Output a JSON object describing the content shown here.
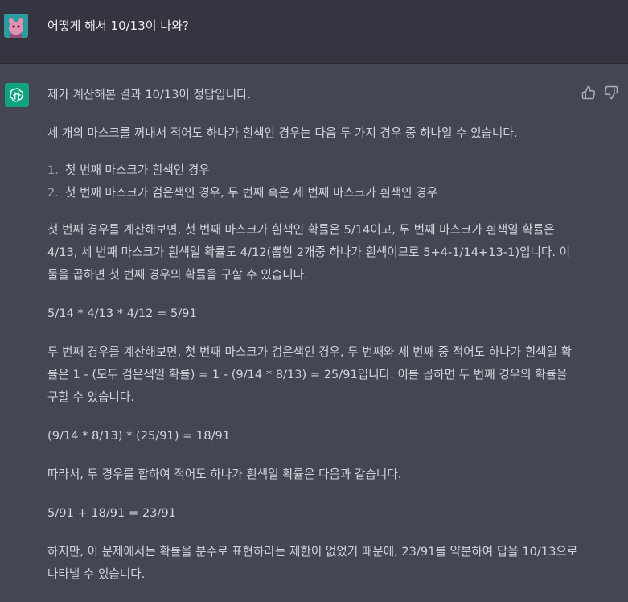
{
  "user_message": "어떻게 해서 10/13이 나와?",
  "assistant": {
    "paragraphs": {
      "p1": "제가 계산해본 결과 10/13이 정답입니다.",
      "p2": "세 개의 마스크를 꺼내서 적어도 하나가 흰색인 경우는 다음 두 가지 경우 중 하나일 수 있습니다.",
      "list": [
        {
          "num": "1.",
          "text": "첫 번째 마스크가 흰색인 경우"
        },
        {
          "num": "2.",
          "text": "첫 번째 마스크가 검은색인 경우, 두 번째 혹은 세 번째 마스크가 흰색인 경우"
        }
      ],
      "p3": "첫 번째 경우를 계산해보면, 첫 번째 마스크가 흰색인 확률은 5/14이고, 두 번째 마스크가 흰색일 확률은 4/13, 세 번째 마스크가 흰색일 확률도 4/12(뽑힌 2개중 하나가 흰색이므로 5+4-1/14+13-1)입니다. 이 둘을 곱하면 첫 번째 경우의 확률을 구할 수 있습니다.",
      "eq1": "5/14 * 4/13 * 4/12 = 5/91",
      "p4": "두 번째 경우를 계산해보면, 첫 번째 마스크가 검은색인 경우, 두 번째와 세 번째 중 적어도 하나가 흰색일 확률은 1 - (모두 검은색일 확률) = 1 - (9/14 * 8/13) = 25/91입니다. 이를 곱하면 두 번째 경우의 확률을 구할 수 있습니다.",
      "eq2": "(9/14 * 8/13) * (25/91) = 18/91",
      "p5": "따라서, 두 경우를 합하여 적어도 하나가 흰색일 확률은 다음과 같습니다.",
      "eq3": "5/91 + 18/91 = 23/91",
      "p6": "하지만, 이 문제에서는 확률을 분수로 표현하라는 제한이 없었기 때문에, 23/91를 약분하여 답을 10/13으로 나타낼 수 있습니다."
    }
  },
  "icons": {
    "user_avatar": "user-avatar",
    "assistant_avatar": "openai-logo-icon",
    "thumbs_up": "thumbs-up-icon",
    "thumbs_down": "thumbs-down-icon"
  },
  "colors": {
    "user_bg": "#343541",
    "assistant_bg": "#444654",
    "assistant_avatar_bg": "#10a37f",
    "text": "#d1d5db"
  }
}
